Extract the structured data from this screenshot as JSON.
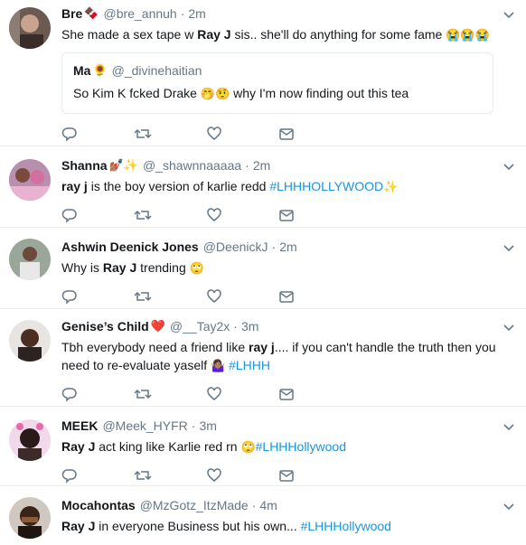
{
  "tweets": [
    {
      "name": "Bre",
      "name_emoji": "🍫",
      "handle": "@bre_annuh",
      "time": "2m",
      "text_parts": [
        "She made a sex tape w ",
        "Ray J",
        " sis.. she'll do anything for some fame ",
        "😭😭😭"
      ],
      "quote": {
        "name": "Ma",
        "name_emoji": "🌻",
        "handle": "@_divinehaitian",
        "text_a": "So Kim K f",
        "text_b": "cked Drake ",
        "emojis": "🤭🤨",
        "text_c": " why I'm now finding out this tea"
      }
    },
    {
      "name": "Shanna",
      "name_emoji": "💅🏽✨",
      "handle": "@_shawnnaaaaa",
      "time": "2m",
      "text_parts": [
        "ray j",
        " is the boy version of karlie redd ",
        "#LHHHOLLYWOOD",
        " ✨"
      ]
    },
    {
      "name": "Ashwin Deenick Jones",
      "handle": "@DeenickJ",
      "time": "2m",
      "text_parts": [
        "Why is ",
        "Ray J",
        " trending ",
        "🙄"
      ]
    },
    {
      "name": "Genise’s Child",
      "name_emoji": "❤️",
      "handle": "@__Tay2x",
      "time": "3m",
      "text_line1": [
        "Tbh everybody need a friend like ",
        "ray j",
        ".... if you can't handle the truth then you"
      ],
      "text_line2": [
        "need to re-evaluate yaself ",
        "🤷🏽‍♀️",
        " ",
        "#LHHH"
      ]
    },
    {
      "name": "MEEK",
      "handle": "@Meek_HYFR",
      "time": "3m",
      "text_parts": [
        "Ray J",
        " act king like Karlie red rn ",
        "🙄",
        "#LHHHollywood"
      ]
    },
    {
      "name": "Mocahontas",
      "handle": "@MzGotz_ItzMade",
      "time": "4m",
      "text_parts": [
        "Ray J",
        " in everyone Business but his own... ",
        "#LHHHollywood"
      ]
    }
  ],
  "sep": "·",
  "colors": {
    "link": "#1b95e0",
    "meta": "#657786",
    "icon": "#657786",
    "border": "#e6ecf0"
  },
  "icons": [
    "reply-icon",
    "retweet-icon",
    "like-icon",
    "message-icon",
    "chevron-down-icon"
  ]
}
